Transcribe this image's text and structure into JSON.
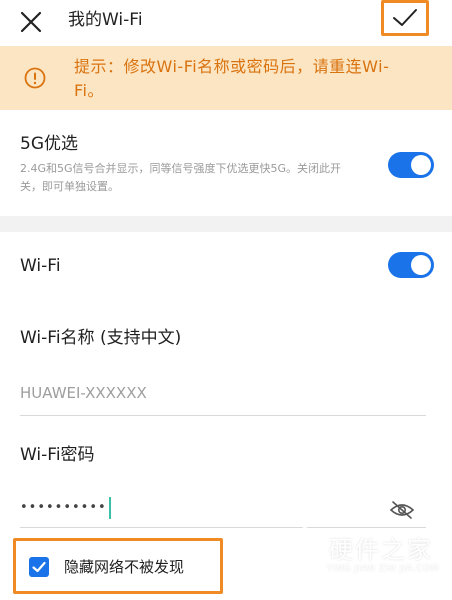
{
  "header": {
    "title": "我的Wi-Fi",
    "close_icon": "close-icon",
    "confirm_icon": "check-icon"
  },
  "notice": {
    "icon": "info-icon",
    "text": "提示：修改Wi-Fi名称或密码后，请重连Wi-Fi。"
  },
  "prefer_5g": {
    "title": "5G优选",
    "description": "2.4G和5G信号合并显示，同等信号强度下优选更快5G。关闭此开关，即可单独设置。",
    "enabled": true
  },
  "wifi": {
    "label": "Wi-Fi",
    "enabled": true
  },
  "name_field": {
    "label": "Wi-Fi名称 (支持中文)",
    "value": "HUAWEI-XXXXXX"
  },
  "password_field": {
    "label": "Wi-Fi密码",
    "value": "••••••••••",
    "visibility_icon": "eye-off-icon"
  },
  "hidden_network": {
    "label": "隐藏网络不被发现",
    "checked": true
  },
  "watermark": {
    "cn": "硬件之家",
    "en": "YING JIAN ZHI JIA.COM"
  },
  "colors": {
    "accent": "#1a73e8",
    "highlight_border": "#f08a24",
    "notice_bg": "#fce5c2",
    "notice_text": "#d9730f"
  }
}
